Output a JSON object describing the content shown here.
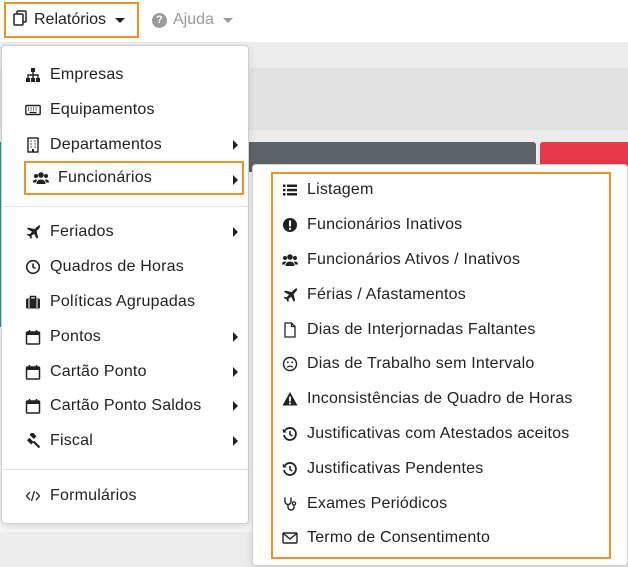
{
  "navbar": {
    "relatorios_label": "Relatórios",
    "ajuda_label": "Ajuda"
  },
  "main_menu": {
    "items": [
      {
        "label": "Empresas",
        "icon": "sitemap-icon"
      },
      {
        "label": "Equipamentos",
        "icon": "keyboard-icon"
      },
      {
        "label": "Departamentos",
        "icon": "building-icon"
      },
      {
        "label": "Funcionários",
        "icon": "users-icon"
      },
      {
        "label": "Feriados",
        "icon": "plane-icon"
      },
      {
        "label": "Quadros de Horas",
        "icon": "clock-icon"
      },
      {
        "label": "Políticas Agrupadas",
        "icon": "briefcase-icon"
      },
      {
        "label": "Pontos",
        "icon": "calendar-icon"
      },
      {
        "label": "Cartão Ponto",
        "icon": "calendar-icon"
      },
      {
        "label": "Cartão Ponto Saldos",
        "icon": "calendar-icon"
      },
      {
        "label": "Fiscal",
        "icon": "gavel-icon"
      },
      {
        "label": "Formulários",
        "icon": "code-icon"
      }
    ]
  },
  "submenu": {
    "items": [
      {
        "label": "Listagem",
        "icon": "list-icon"
      },
      {
        "label": "Funcionários Inativos",
        "icon": "exclamation-circle-icon"
      },
      {
        "label": "Funcionários Ativos / Inativos",
        "icon": "users-icon"
      },
      {
        "label": "Férias / Afastamentos",
        "icon": "plane-icon"
      },
      {
        "label": "Dias de Interjornadas Faltantes",
        "icon": "file-icon"
      },
      {
        "label": "Dias de Trabalho sem Intervalo",
        "icon": "frown-icon"
      },
      {
        "label": "Inconsistências de Quadro de Horas",
        "icon": "warning-triangle-icon"
      },
      {
        "label": "Justificativas com Atestados aceitos",
        "icon": "history-icon"
      },
      {
        "label": "Justificativas Pendentes",
        "icon": "history-icon"
      },
      {
        "label": "Exames Periódicos",
        "icon": "stethoscope-icon"
      },
      {
        "label": "Termo de Consentimento",
        "icon": "envelope-icon"
      }
    ]
  },
  "colors": {
    "highlight": "#f0912f",
    "dark_bar": "#5d6367",
    "red_bar": "#e8374a"
  }
}
